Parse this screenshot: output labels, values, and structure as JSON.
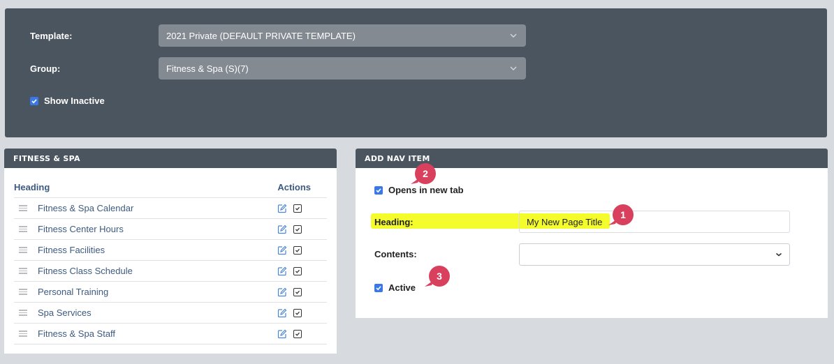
{
  "filters": {
    "template_label": "Template:",
    "template_value": "2021 Private (DEFAULT PRIVATE TEMPLATE)",
    "group_label": "Group:",
    "group_value": "Fitness & Spa (S)(7)",
    "show_inactive_label": "Show Inactive",
    "show_inactive_checked": true
  },
  "nav_list": {
    "title": "FITNESS & SPA",
    "col_heading": "Heading",
    "col_actions": "Actions",
    "items": [
      {
        "title": "Fitness & Spa Calendar",
        "active": true
      },
      {
        "title": "Fitness Center Hours",
        "active": true
      },
      {
        "title": "Fitness Facilities",
        "active": true
      },
      {
        "title": "Fitness Class Schedule",
        "active": true
      },
      {
        "title": "Personal Training",
        "active": true
      },
      {
        "title": "Spa Services",
        "active": true
      },
      {
        "title": "Fitness & Spa Staff",
        "active": true
      }
    ]
  },
  "add_nav": {
    "title": "ADD NAV ITEM",
    "opens_new_tab_label": "Opens in new tab",
    "opens_new_tab_checked": true,
    "heading_label": "Heading:",
    "heading_value": "My New Page Title",
    "contents_label": "Contents:",
    "contents_value": "",
    "active_label": "Active",
    "active_checked": true
  },
  "annotations": [
    {
      "number": "1",
      "target": "heading-field"
    },
    {
      "number": "2",
      "target": "opens-new-tab-checkbox"
    },
    {
      "number": "3",
      "target": "active-checkbox"
    }
  ],
  "colors": {
    "panel_dark": "#4b555f",
    "link_text": "#3d5a80",
    "annotation": "#d8405e",
    "highlight": "#f4fc2c",
    "checkbox": "#3b78e7"
  }
}
